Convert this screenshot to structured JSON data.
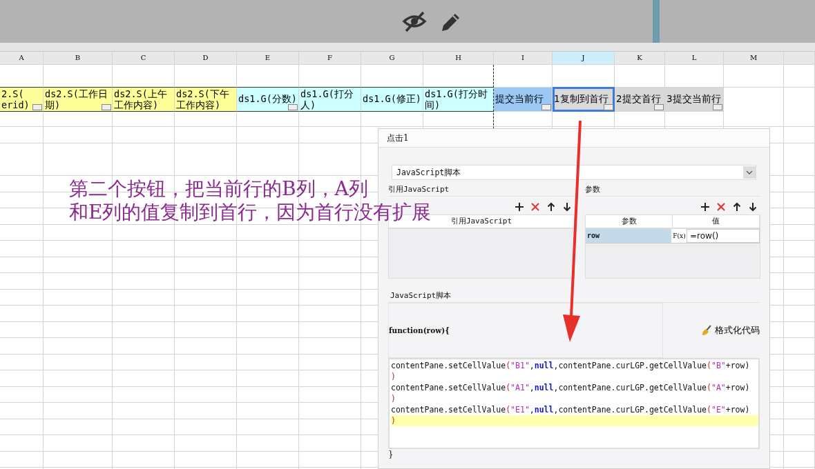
{
  "sheet": {
    "columns": [
      {
        "label": "A",
        "selected": false
      },
      {
        "label": "B",
        "selected": false
      },
      {
        "label": "C",
        "selected": false
      },
      {
        "label": "D",
        "selected": false
      },
      {
        "label": "E",
        "selected": false
      },
      {
        "label": "F",
        "selected": false
      },
      {
        "label": "G",
        "selected": false
      },
      {
        "label": "H",
        "selected": false
      },
      {
        "label": "I",
        "selected": false
      },
      {
        "label": "J",
        "selected": true
      },
      {
        "label": "K",
        "selected": false
      },
      {
        "label": "L",
        "selected": false
      },
      {
        "label": "M",
        "selected": false
      }
    ],
    "data_row": [
      {
        "kind": "field",
        "text": "2.S(\nerid)",
        "color": "#ffff99",
        "widget": true,
        "selected": false
      },
      {
        "kind": "field",
        "text": "ds2.S(工作日期)",
        "color": "#ffff99",
        "widget": true,
        "selected": false
      },
      {
        "kind": "field",
        "text": "ds2.S(上午工作内容)",
        "color": "#ffff99",
        "widget": false,
        "selected": false
      },
      {
        "kind": "field",
        "text": "ds2.S(下午工作内容)",
        "color": "#ffff99",
        "widget": false,
        "selected": false
      },
      {
        "kind": "field",
        "text": "ds1.G(分数)",
        "color": "#ccffff",
        "widget": true,
        "selected": false
      },
      {
        "kind": "field",
        "text": "ds1.G(打分人)",
        "color": "#ccffff",
        "widget": false,
        "selected": false
      },
      {
        "kind": "field",
        "text": "ds1.G(修正)",
        "color": "#ccffff",
        "widget": false,
        "selected": false
      },
      {
        "kind": "field",
        "text": "ds1.G(打分时间)",
        "color": "#ccffff",
        "widget": false,
        "selected": false
      },
      {
        "kind": "button",
        "text": "提交当前行",
        "color": "#99c8f4",
        "widget": true,
        "selected": false
      },
      {
        "kind": "button",
        "text": "1复制到首行",
        "color": "#d9d9d9",
        "widget": true,
        "selected": true
      },
      {
        "kind": "button",
        "text": "2提交首行",
        "color": "#d9d9d9",
        "widget": true,
        "selected": false
      },
      {
        "kind": "button",
        "text": "3提交当前行",
        "color": "#d9d9d9",
        "widget": true,
        "selected": false
      }
    ]
  },
  "note": {
    "lines": [
      "第二个按钮，把当前行的B列，A列",
      "和E列的值复制到首行，因为首行没有扩展"
    ]
  },
  "dialog": {
    "title": "点击1",
    "type_dropdown": {
      "value": "JavaScript脚本"
    },
    "ref_section": {
      "label": "引用JavaScript",
      "column": "引用JavaScript"
    },
    "param_section": {
      "label": "参数",
      "columns": [
        "参数",
        "值"
      ],
      "rows": [
        {
          "name": "row",
          "formula_button": "F(x)",
          "value": "=row()",
          "selected": true
        }
      ]
    },
    "script_section": {
      "label": "JavaScript脚本",
      "signature": "function(row){",
      "format_button": "格式化代码",
      "closing": "}",
      "lines": [
        {
          "highlighted": false,
          "tokens": [
            {
              "kind": "plain",
              "text": "contentPane.setCellValue"
            },
            {
              "kind": "paren",
              "text": "("
            },
            {
              "kind": "string",
              "text": "\"B1\""
            },
            {
              "kind": "plain",
              "text": ","
            },
            {
              "kind": "keyword",
              "text": "null"
            },
            {
              "kind": "plain",
              "text": ",contentPane.curLGP.getCellValue"
            },
            {
              "kind": "paren",
              "text": "("
            },
            {
              "kind": "string",
              "text": "\"B\""
            },
            {
              "kind": "plain",
              "text": "+row)"
            }
          ]
        },
        {
          "highlighted": false,
          "tokens": [
            {
              "kind": "paren",
              "text": ")"
            }
          ]
        },
        {
          "highlighted": false,
          "tokens": [
            {
              "kind": "plain",
              "text": "contentPane.setCellValue"
            },
            {
              "kind": "paren",
              "text": "("
            },
            {
              "kind": "string",
              "text": "\"A1\""
            },
            {
              "kind": "plain",
              "text": ","
            },
            {
              "kind": "keyword",
              "text": "null"
            },
            {
              "kind": "plain",
              "text": ",contentPane.curLGP.getCellValue"
            },
            {
              "kind": "paren",
              "text": "("
            },
            {
              "kind": "string",
              "text": "\"A\""
            },
            {
              "kind": "plain",
              "text": "+row)"
            }
          ]
        },
        {
          "highlighted": false,
          "tokens": [
            {
              "kind": "paren",
              "text": ")"
            }
          ]
        },
        {
          "highlighted": false,
          "tokens": [
            {
              "kind": "plain",
              "text": "contentPane.setCellValue"
            },
            {
              "kind": "paren",
              "text": "("
            },
            {
              "kind": "string",
              "text": "\"E1\""
            },
            {
              "kind": "plain",
              "text": ","
            },
            {
              "kind": "keyword",
              "text": "null"
            },
            {
              "kind": "plain",
              "text": ",contentPane.curLGP.getCellValue"
            },
            {
              "kind": "paren",
              "text": "("
            },
            {
              "kind": "string",
              "text": "\"E\""
            },
            {
              "kind": "plain",
              "text": "+row)"
            }
          ]
        },
        {
          "highlighted": true,
          "tokens": [
            {
              "kind": "paren",
              "text": ")"
            }
          ]
        }
      ]
    }
  }
}
